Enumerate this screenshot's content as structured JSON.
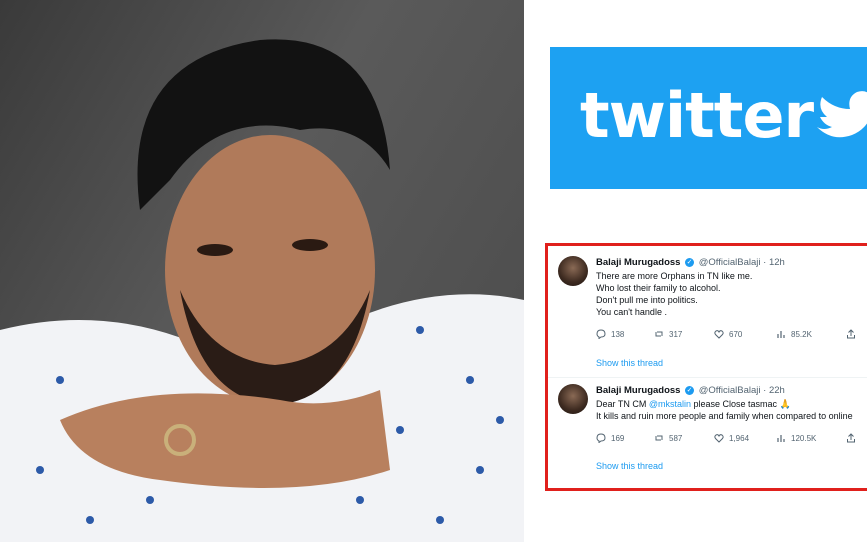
{
  "banner": {
    "logo_text": "twitter",
    "brand_color": "#1da1f2"
  },
  "highlight_color": "#e0201c",
  "tweets": [
    {
      "name": "Balaji Murugadoss",
      "handle": "@OfficialBalaji",
      "time": "· 12h",
      "lines": [
        "There are more Orphans in TN like me.",
        "Who lost their family to alcohol.",
        "Don't pull me into politics.",
        "You can't handle ."
      ],
      "replies": "138",
      "retweets": "317",
      "likes": "670",
      "views": "85.2K",
      "show_thread": "Show this thread"
    },
    {
      "name": "Balaji Murugadoss",
      "handle": "@OfficialBalaji",
      "time": "· 22h",
      "line1_pre": "Dear TN CM ",
      "mention": "@mkstalin",
      "line1_post": " please Close tasmac 🙏",
      "line2": "It kills and ruin more people and family when compared to online",
      "replies": "169",
      "retweets": "587",
      "likes": "1,964",
      "views": "120.5K",
      "show_thread": "Show this thread"
    }
  ]
}
